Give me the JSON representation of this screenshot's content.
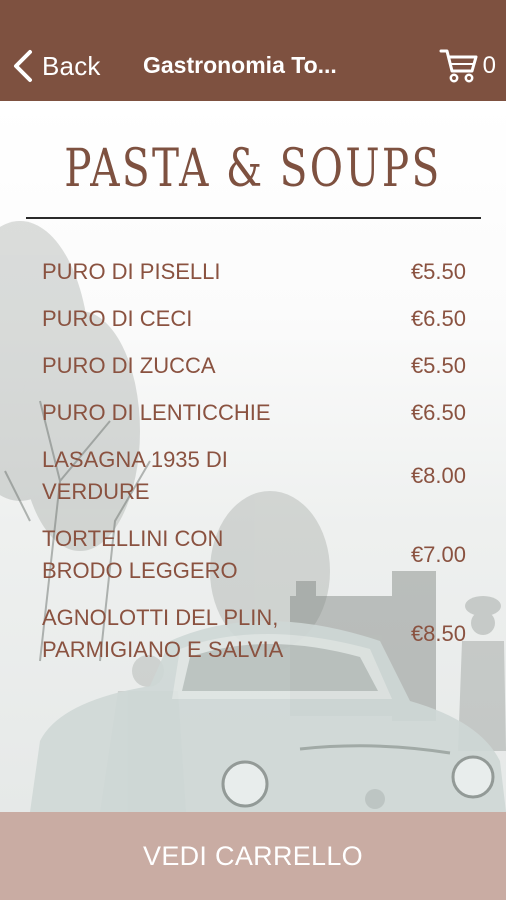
{
  "navbar": {
    "back_label": "Back",
    "title": "Gastronomia To...",
    "cart_count": "0",
    "color": "#7e5140"
  },
  "section": {
    "heading": "PASTA & SOUPS"
  },
  "menu": {
    "items": [
      {
        "name": "PURO DI PISELLI",
        "price": "€5.50"
      },
      {
        "name": "PURO DI CECI",
        "price": "€6.50"
      },
      {
        "name": "PURO DI ZUCCA",
        "price": "€5.50"
      },
      {
        "name": "PURO DI LENTICCHIE",
        "price": "€6.50"
      },
      {
        "name": "LASAGNA 1935 DI VERDURE",
        "price": "€8.00"
      },
      {
        "name": "TORTELLINI CON BRODO LEGGERO",
        "price": "€7.00"
      },
      {
        "name": "AGNOLOTTI DEL PLIN, PARMIGIANO E SALVIA",
        "price": "€8.50"
      }
    ]
  },
  "footer": {
    "button_label": "VEDI CARRELLO",
    "color": "#c9aca3"
  },
  "icons": {
    "back": "chevron-left-icon",
    "cart": "shopping-cart-icon"
  }
}
